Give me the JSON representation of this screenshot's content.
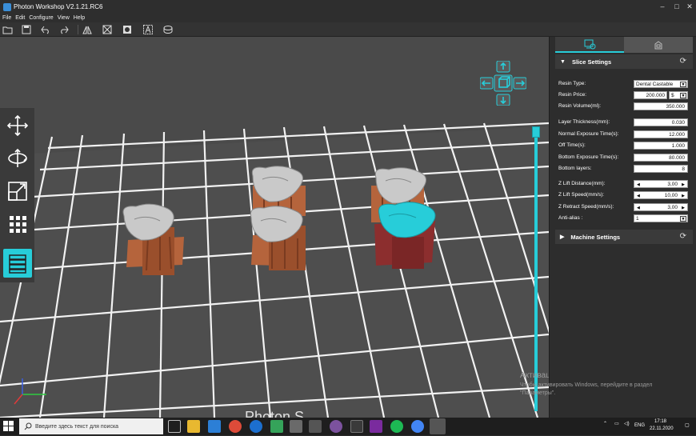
{
  "window": {
    "title": "Photon Workshop V2.1.21.RC6"
  },
  "menu": [
    "File",
    "Edit",
    "Configure",
    "View",
    "Help"
  ],
  "toolbar": [
    "open-icon",
    "save-icon",
    "undo-icon",
    "redo-icon",
    "mirror-icon",
    "hollow-icon",
    "punch-icon",
    "text-icon",
    "slice-icon"
  ],
  "left_tools": [
    "move-icon",
    "rotate-icon",
    "scale-icon",
    "arrange-icon",
    "layers-icon"
  ],
  "panel": {
    "tabs": [
      "print-settings-tab",
      "machine-tab"
    ],
    "slice_settings_title": "Slice Settings",
    "machine_settings_title": "Machine Settings",
    "resin_type_label": "Resin Type:",
    "resin_type_value": "Dental Castable",
    "resin_price_label": "Resin Price:",
    "resin_price_value": "200.000",
    "resin_price_currency": "$",
    "resin_volume_label": "Resin Volume(ml):",
    "resin_volume_value": "350.000",
    "layer_thickness_label": "Layer Thickness(mm):",
    "layer_thickness_value": "0.030",
    "normal_exposure_label": "Normal Exposure Time(s):",
    "normal_exposure_value": "12.000",
    "off_time_label": "Off Time(s):",
    "off_time_value": "1.000",
    "bottom_exposure_label": "Bottom Exposure Time(s):",
    "bottom_exposure_value": "80.000",
    "bottom_layers_label": "Bottom layers:",
    "bottom_layers_value": "8",
    "z_lift_distance_label": "Z Lift Distance(mm):",
    "z_lift_distance_value": "3,00",
    "z_lift_speed_label": "Z Lift Speed(mm/s):",
    "z_lift_speed_value": "10,00",
    "z_retract_speed_label": "Z Retract Speed(mm/s):",
    "z_retract_speed_value": "3,00",
    "anti_alias_label": "Anti-alias :",
    "anti_alias_value": "1"
  },
  "viewport": {
    "bed_text": "Photon S",
    "layer_slider_level": 1.0
  },
  "watermark": {
    "line1": "Активация Windows",
    "line2": "Чтобы активировать Windows, перейдите в раздел",
    "line3": "\"Параметры\"."
  },
  "taskbar": {
    "search_placeholder": "Введите здесь текст для поиска",
    "lang": "ENG",
    "time": "17:18",
    "date": "22.11.2020"
  },
  "colors": {
    "accent": "#27cdd9",
    "model": "#c8c8c8",
    "model_selected": "#27cdd9",
    "support": "#b5643c",
    "support_selected": "#8c2e2e"
  }
}
